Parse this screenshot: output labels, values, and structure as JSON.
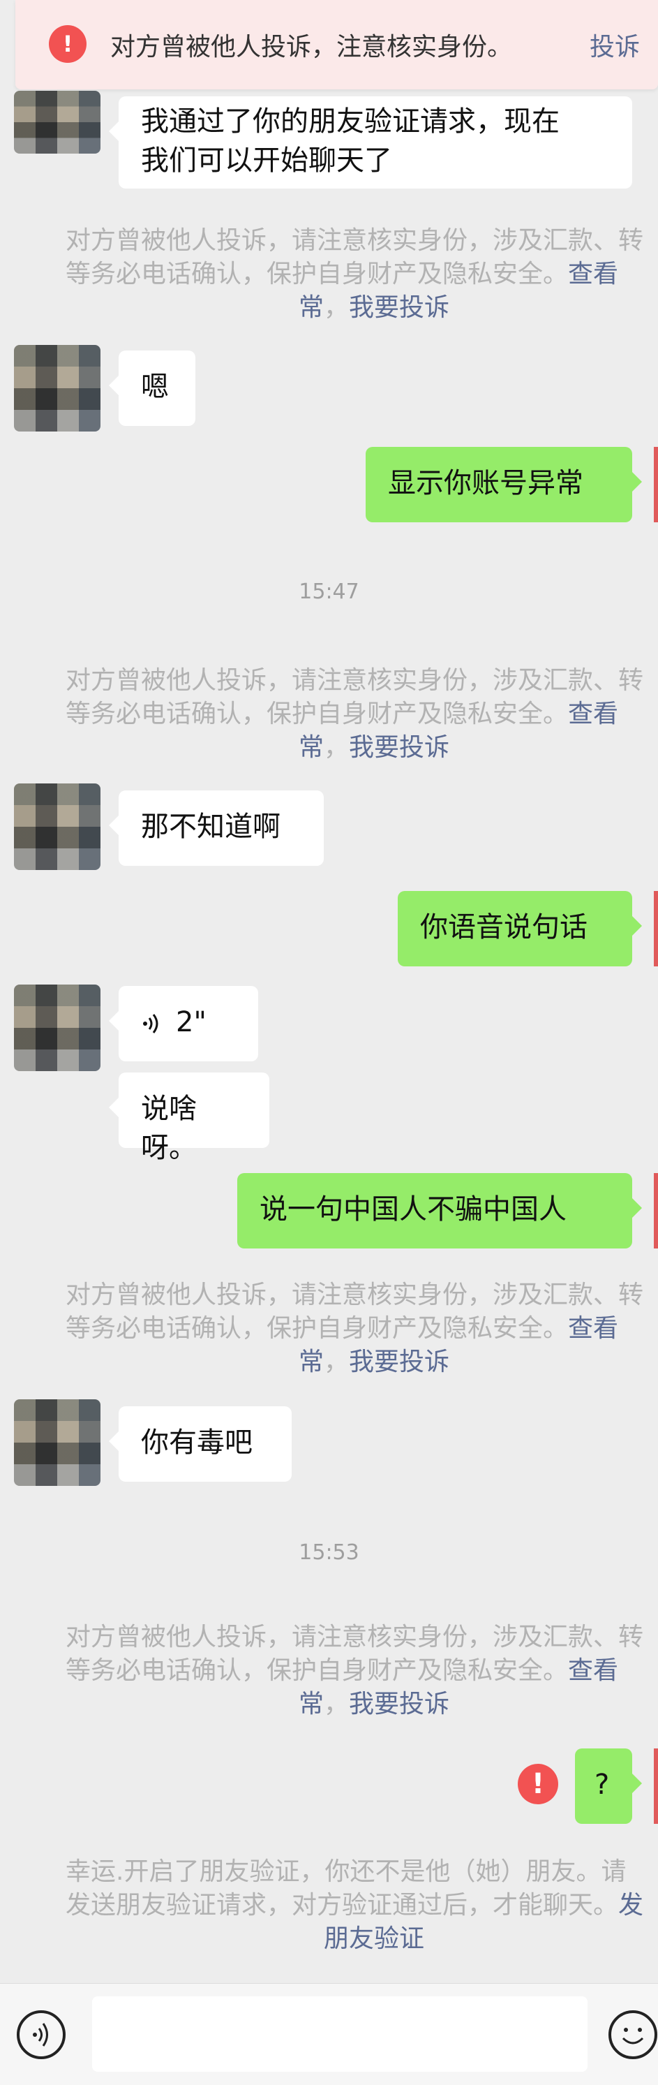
{
  "banner": {
    "icon": "!",
    "text": "对方曾被他人投诉，注意核实身份。",
    "link": "投诉"
  },
  "warning": {
    "line1": "对方曾被他人投诉，请注意核实身份，涉及汇款、转",
    "line2_text": "等务必电话确认，保护自身财产及隐私安全。",
    "line2_link": "查看",
    "line3_link1": "常",
    "line3_sep": "，",
    "line3_link2": "我要投诉"
  },
  "messages": {
    "m1": "我通过了你的朋友验证请求，现在\n我们可以开始聊天了",
    "m2": "嗯",
    "m3": "显示你账号异常",
    "m4": "那不知道啊",
    "m5": "你语音说句话",
    "m6_duration": "2\"",
    "m7": "说啥呀。",
    "m8": "说一句中国人不骗中国人",
    "m9": "你有毒吧",
    "m10": "?"
  },
  "timestamps": {
    "t1": "15:47",
    "t2": "15:53"
  },
  "final_notice": {
    "line1": "幸运.开启了朋友验证，你还不是他（她）朋友。请",
    "line2_text": "发送朋友验证请求，对方验证通过后，才能聊天。",
    "line2_link": "发",
    "line3_link": "朋友验证"
  },
  "error_icon": "!",
  "input": {
    "placeholder": ""
  },
  "colors": {
    "background": "#ededed",
    "self_bubble": "#95ec69",
    "link": "#5b6b93",
    "error": "#f25252"
  }
}
